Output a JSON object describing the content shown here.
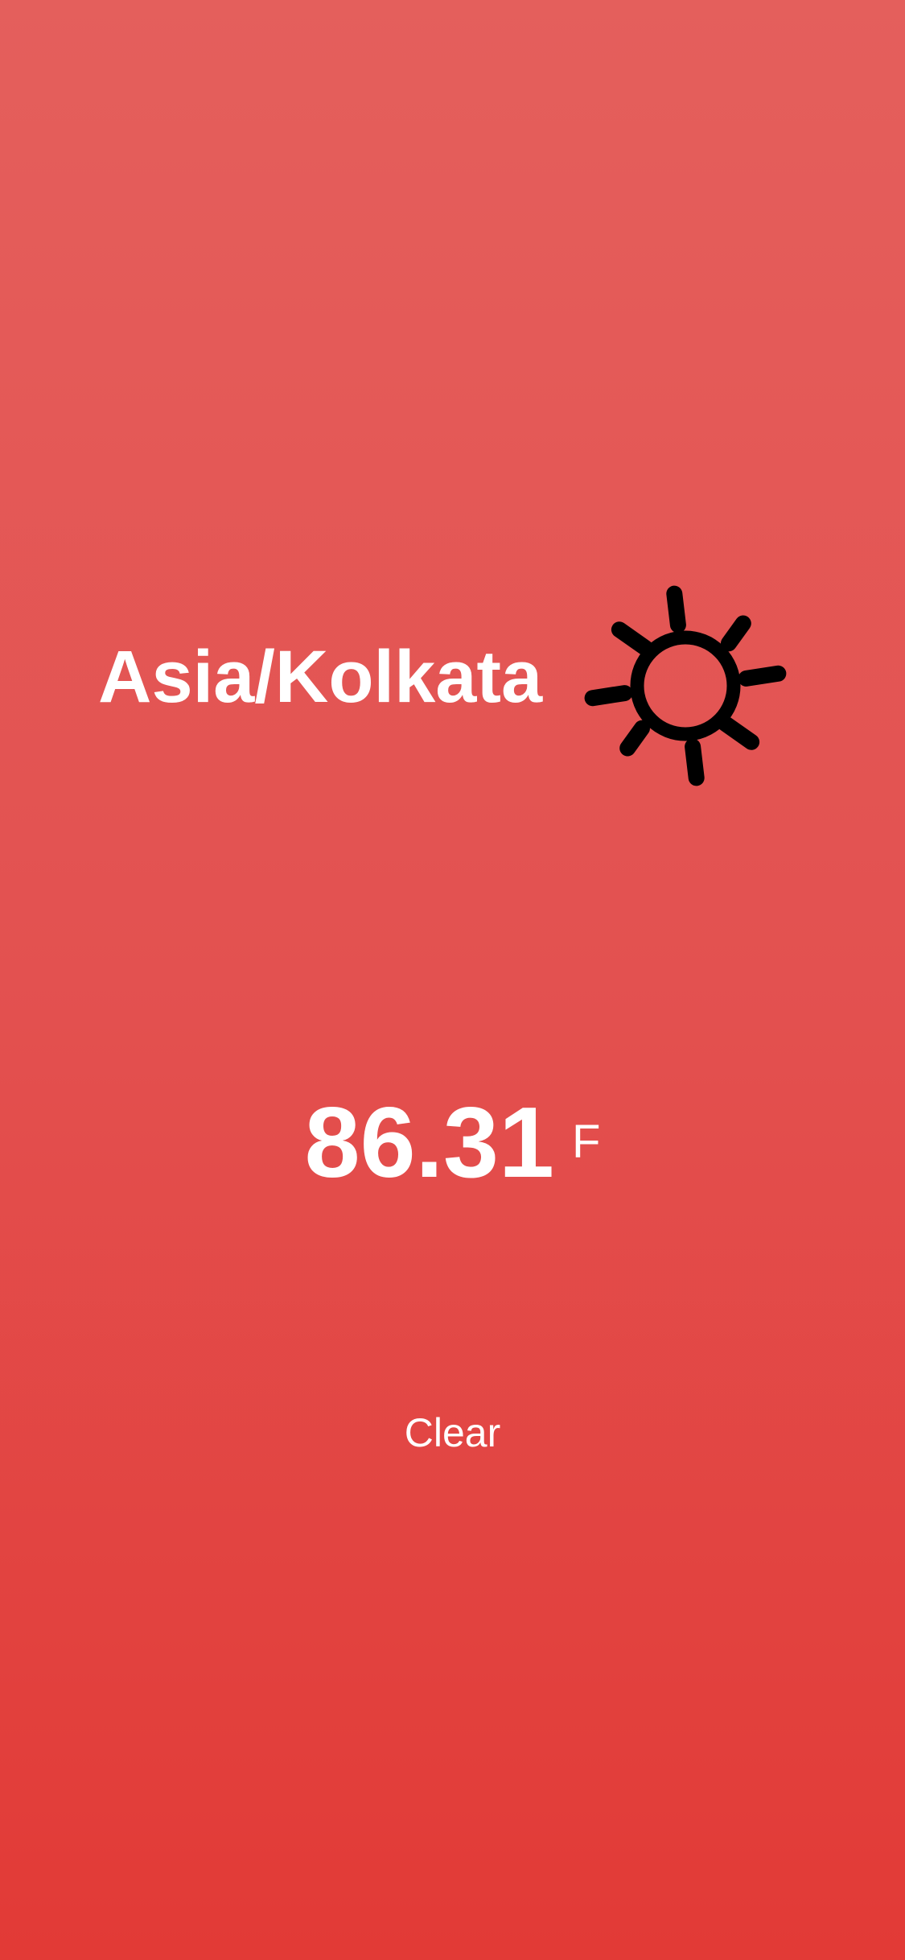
{
  "weather": {
    "location": "Asia/Kolkata",
    "temperature": "86.31",
    "unit": "F",
    "condition": "Clear",
    "icon": "sun-icon"
  },
  "colors": {
    "background_top": "#e45f5c",
    "background_bottom": "#e23a36",
    "text": "#ffffff",
    "icon": "#000000"
  }
}
